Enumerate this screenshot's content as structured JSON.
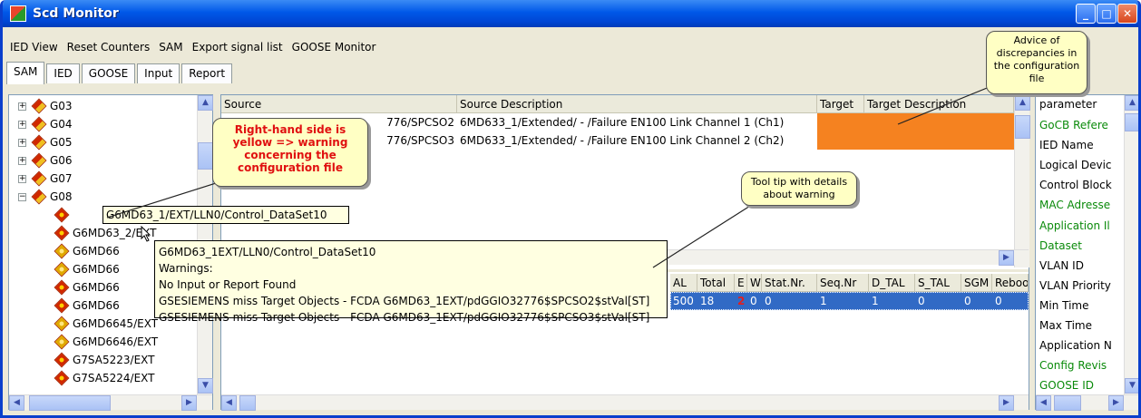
{
  "window": {
    "title": "Scd Monitor"
  },
  "menu": [
    "IED View",
    "Reset Counters",
    "SAM",
    "Export signal list",
    "GOOSE Monitor"
  ],
  "tabs": [
    "SAM",
    "IED",
    "GOOSE",
    "Input",
    "Report"
  ],
  "tree": {
    "groups": [
      "G03",
      "G04",
      "G05",
      "G06",
      "G07",
      "G08"
    ],
    "children": [
      "G6MD63_1/EXT/LLN0/Control_DataSet10",
      "G6MD63_2/EXT",
      "G6MD66",
      "G6MD66",
      "G6MD66",
      "G6MD66",
      "G6MD6645/EXT",
      "G6MD6646/EXT",
      "G7SA5223/EXT",
      "G7SA5224/EXT"
    ]
  },
  "upper_grid": {
    "headers": [
      "Source",
      "Source Description",
      "Target",
      "Target Description"
    ],
    "rows": [
      {
        "source": "776/SPCSO2",
        "desc": "6MD633_1/Extended/ - /Failure EN100 Link Channel 1 (Ch1)"
      },
      {
        "source": "776/SPCSO3",
        "desc": "6MD633_1/Extended/ - /Failure EN100 Link Channel 2 (Ch2)"
      }
    ]
  },
  "lower_grid": {
    "headers": [
      "AL",
      "Total",
      "E",
      "W",
      "Stat.Nr.",
      "Seq.Nr",
      "D_TAL",
      "S_TAL",
      "SGM",
      "Reboo"
    ],
    "row": [
      "500",
      "18",
      "2",
      "0",
      "0",
      "1",
      "1",
      "0",
      "0",
      "0"
    ]
  },
  "properties": [
    "parameter",
    "GoCB Refere",
    "IED Name",
    "Logical Devic",
    "Control Block",
    "MAC Adresse",
    "Application Il",
    "Dataset",
    "VLAN ID",
    "VLAN Priority",
    "Min Time",
    "Max Time",
    "Application N",
    "Config Revis",
    "GOOSE ID"
  ],
  "colors": {
    "green_prop": "#0a8a0a",
    "warning_fill": "#f58220",
    "selection": "#316ac5"
  },
  "callouts": {
    "right_hand": "Right-hand side is yellow => warning concerning the configuration file",
    "advice": "Advice of discrepancies in the configuration file",
    "tooltip_note": "Tool tip with details about warning"
  },
  "tooltip": {
    "path": "G6MD63_1/EXT/LLN0/Control_DataSet10",
    "title": "G6MD63_1EXT/LLN0/Control_DataSet10",
    "label": "Warnings:",
    "line1": "No Input or Report Found",
    "line2": "GSESIEMENS miss Target Objects - FCDA G6MD63_1EXT/pdGGIO32776$SPCSO2$stVal[ST]",
    "line3": "GSESIEMENS miss Target Objects - FCDA G6MD63_1EXT/pdGGIO32776$SPCSO3$stVal[ST]"
  }
}
